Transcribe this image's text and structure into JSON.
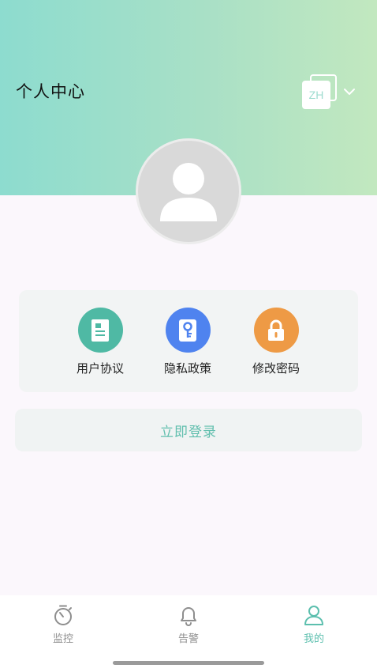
{
  "header": {
    "title": "个人中心",
    "language_code": "ZH"
  },
  "menu": {
    "items": [
      {
        "label": "用户协议",
        "icon": "document-icon",
        "color": "#4fb9a4"
      },
      {
        "label": "隐私政策",
        "icon": "key-icon",
        "color": "#4f83ef"
      },
      {
        "label": "修改密码",
        "icon": "lock-icon",
        "color": "#ee9a45"
      }
    ]
  },
  "login": {
    "label": "立即登录"
  },
  "tabbar": {
    "tabs": [
      {
        "label": "监控",
        "icon": "stopwatch-icon"
      },
      {
        "label": "告警",
        "icon": "bell-icon"
      },
      {
        "label": "我的",
        "icon": "person-icon",
        "active": true
      }
    ]
  },
  "colors": {
    "accent": "#5cbfae",
    "header_gradient_start": "#8ddccf",
    "header_gradient_end": "#c2e8bf"
  }
}
